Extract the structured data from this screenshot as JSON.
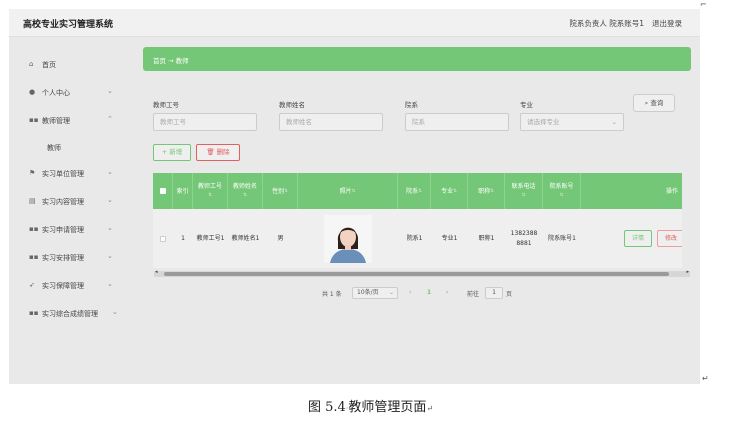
{
  "header": {
    "app_title": "高校专业实习管理系统",
    "user_info": "院系负责人 院系账号1",
    "logout_label": "退出登录"
  },
  "sidebar": {
    "items": [
      {
        "label": "首页",
        "icon": "home-icon"
      },
      {
        "label": "个人中心",
        "icon": "user-icon"
      },
      {
        "label": "教师管理",
        "icon": "grid-icon"
      },
      {
        "label": "教师",
        "icon": ""
      },
      {
        "label": "实习单位管理",
        "icon": "flag-icon"
      },
      {
        "label": "实习内容管理",
        "icon": "doc-icon"
      },
      {
        "label": "实习申请管理",
        "icon": "grid-icon"
      },
      {
        "label": "实习安排管理",
        "icon": "grid-icon"
      },
      {
        "label": "实习保障管理",
        "icon": "send-icon"
      },
      {
        "label": "实习综合成绩管理",
        "icon": "grid-icon"
      }
    ]
  },
  "breadcrumb": {
    "home": "首页",
    "arrow": "→",
    "current": "教师"
  },
  "search": {
    "fields": [
      {
        "label": "教师工号",
        "placeholder": "教师工号"
      },
      {
        "label": "教师姓名",
        "placeholder": "教师姓名"
      },
      {
        "label": "院系",
        "placeholder": "院系"
      },
      {
        "label": "专业",
        "placeholder": "请选择专业"
      }
    ],
    "query_label": "查询"
  },
  "actions": {
    "add_label": "+ 新增",
    "delete_label": "删除"
  },
  "table": {
    "headers": [
      "索引",
      "教师工号",
      "教师姓名",
      "性别",
      "照片",
      "院系",
      "专业",
      "职称",
      "联系电话",
      "院系账号",
      "操作"
    ],
    "row": {
      "index": "1",
      "teacher_id": "教师工号1",
      "teacher_name": "教师姓名1",
      "gender": "男",
      "department": "院系1",
      "major": "专业1",
      "title": "职称1",
      "phone": "13823888881",
      "dept_account": "院系账号1",
      "detail_label": "详情",
      "edit_label": "修改"
    }
  },
  "pagination": {
    "total": "共 1 条",
    "page_size": "10条/页",
    "current_page": "1",
    "goto_label": "前往",
    "goto_value": "1",
    "page_unit": "页"
  },
  "caption": {
    "figure_no": "图 5.4",
    "text": "教师管理页面"
  },
  "colors": {
    "accent": "#74c777",
    "danger": "#e06060",
    "detail": "#74c777"
  }
}
